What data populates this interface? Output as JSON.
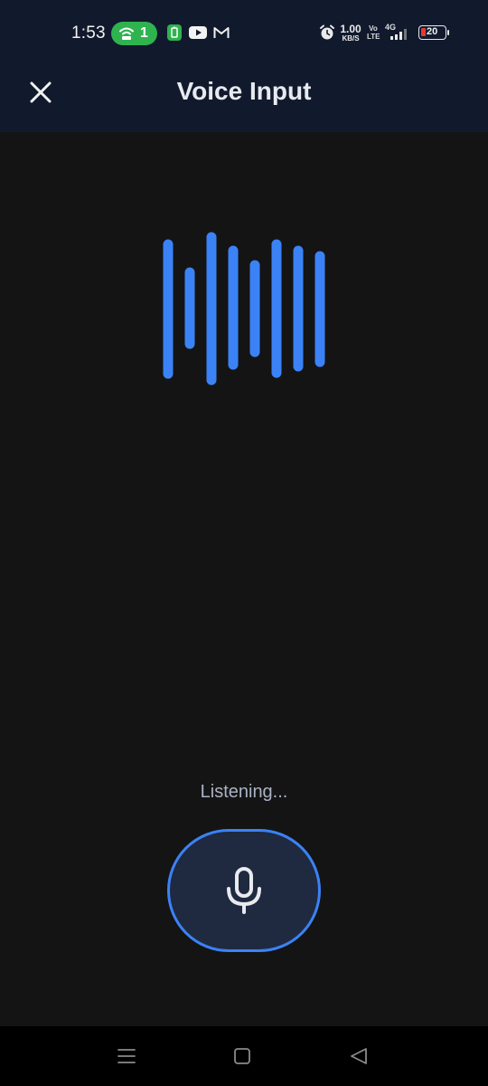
{
  "status_bar": {
    "time": "1:53",
    "hotspot_count": "1",
    "speed_value": "1.00",
    "speed_unit": "KB/S",
    "volte_top": "Vo",
    "volte_bottom": "LTE",
    "network": "4G",
    "battery_level": "20",
    "icons": [
      "hotspot-icon",
      "battery-saver-app-icon",
      "youtube-icon",
      "gmail-icon",
      "alarm-icon",
      "signal-icon"
    ]
  },
  "header": {
    "title": "Voice Input",
    "close_icon": "close-icon"
  },
  "main": {
    "waveform_icon": "audio-waveform-icon",
    "status_text": "Listening...",
    "mic_icon": "microphone-icon"
  },
  "nav_bar": {
    "icons": [
      "recents-icon",
      "home-icon",
      "back-icon"
    ]
  },
  "colors": {
    "header_bg": "#111a2d",
    "body_bg": "#141414",
    "accent": "#3b82f6",
    "mic_button_bg": "#1f2a40",
    "hotspot_green": "#2fb34f",
    "battery_low": "#e53935"
  }
}
